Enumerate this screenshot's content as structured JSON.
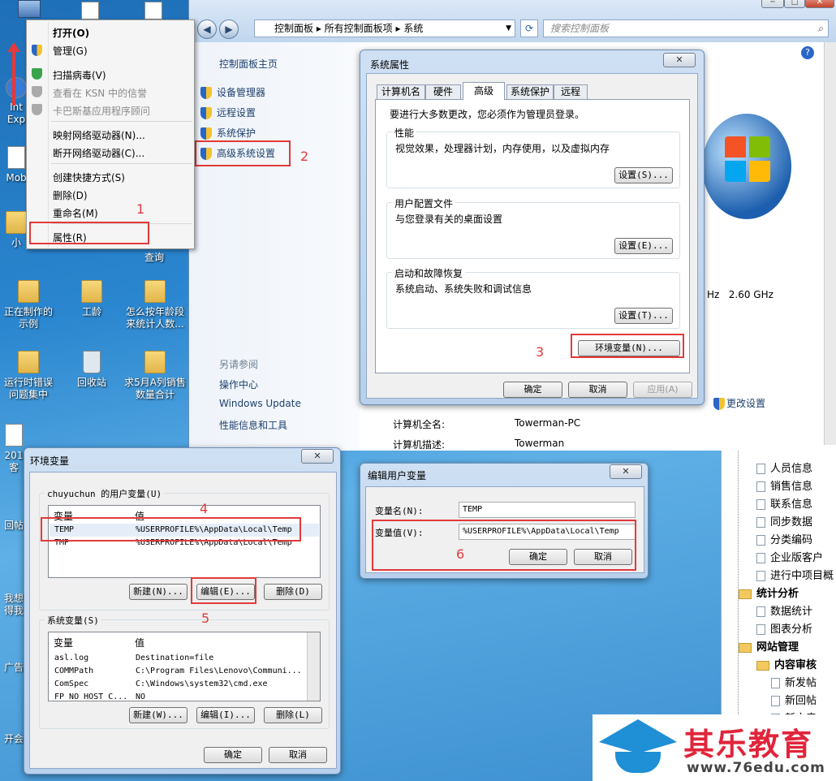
{
  "desktop": {
    "icons": [
      {
        "label": "Int Exp"
      },
      {
        "label": "Mob"
      },
      {
        "label": "小"
      },
      {
        "label": "正在制作的示例"
      },
      {
        "label": "工龄"
      },
      {
        "label": "怎么按年龄段来统计人数..."
      },
      {
        "label": "运行时错误问题集中"
      },
      {
        "label": "回收站"
      },
      {
        "label": "求5月A列销售数量合计"
      },
      {
        "label": "201 客"
      },
      {
        "label": "回帖"
      },
      {
        "label": "我想 得我"
      },
      {
        "label": "广告"
      },
      {
        "label": "开会"
      },
      {
        "label": "查询"
      }
    ]
  },
  "context_menu": {
    "items": [
      "打开(O)",
      "管理(G)",
      "扫描病毒(V)",
      "查看在 KSN 中的信誉",
      "卡巴斯基应用程序顾问",
      "映射网络驱动器(N)...",
      "断开网络驱动器(C)...",
      "创建快捷方式(S)",
      "删除(D)",
      "重命名(M)",
      "属性(R)"
    ]
  },
  "control_panel": {
    "breadcrumb": [
      "控制面板",
      "所有控制面板项",
      "系统"
    ],
    "search_placeholder": "搜索控制面板",
    "home": "控制面板主页",
    "links": [
      "设备管理器",
      "远程设置",
      "系统保护",
      "高级系统设置"
    ],
    "see_also": "另请参阅",
    "see_also_links": [
      "操作中心",
      "Windows Update",
      "性能信息和工具"
    ],
    "cpu_speed": "Hz   2.60 GHz",
    "change_settings": "更改设置",
    "computer_name_label": "计算机全名:",
    "computer_name_value": "Towerman-PC",
    "computer_desc_label": "计算机描述:",
    "computer_desc_value": "Towerman"
  },
  "sys_props": {
    "title": "系统属性",
    "tabs": [
      "计算机名",
      "硬件",
      "高级",
      "系统保护",
      "远程"
    ],
    "admin_note": "要进行大多数更改，您必须作为管理员登录。",
    "perf_title": "性能",
    "perf_desc": "视觉效果，处理器计划，内存使用，以及虚拟内存",
    "perf_btn": "设置(S)...",
    "profile_title": "用户配置文件",
    "profile_desc": "与您登录有关的桌面设置",
    "profile_btn": "设置(E)...",
    "startup_title": "启动和故障恢复",
    "startup_desc": "系统启动、系统失败和调试信息",
    "startup_btn": "设置(T)...",
    "env_btn": "环境变量(N)...",
    "ok": "确定",
    "cancel": "取消",
    "apply": "应用(A)"
  },
  "env_vars": {
    "title": "环境变量",
    "user_group": "chuyuchun 的用户变量(U)",
    "col_var": "变量",
    "col_val": "值",
    "user_rows": [
      {
        "name": "TEMP",
        "value": "%USERPROFILE%\\AppData\\Local\\Temp"
      },
      {
        "name": "TMP",
        "value": "%USERPROFILE%\\AppData\\Local\\Temp"
      }
    ],
    "new_btn": "新建(N)...",
    "edit_btn": "编辑(E)...",
    "delete_btn": "删除(D)",
    "sys_group": "系统变量(S)",
    "sys_rows": [
      {
        "name": "asl.log",
        "value": "Destination=file"
      },
      {
        "name": "COMMPath",
        "value": "C:\\Program Files\\Lenovo\\Communi..."
      },
      {
        "name": "ComSpec",
        "value": "C:\\Windows\\system32\\cmd.exe"
      },
      {
        "name": "FP_NO_HOST_C...",
        "value": "NO"
      }
    ],
    "sys_new_btn": "新建(W)...",
    "sys_edit_btn": "编辑(I)...",
    "sys_delete_btn": "删除(L)",
    "ok": "确定",
    "cancel": "取消"
  },
  "edit_var": {
    "title": "编辑用户变量",
    "name_label": "变量名(N):",
    "name_value": "TEMP",
    "value_label": "变量值(V):",
    "value_value": "%USERPROFILE%\\AppData\\Local\\Temp",
    "ok": "确定",
    "cancel": "取消"
  },
  "tree": {
    "items": [
      {
        "label": "人员信息",
        "kind": "people"
      },
      {
        "label": "销售信息",
        "kind": "doc"
      },
      {
        "label": "联系信息",
        "kind": "doc"
      },
      {
        "label": "同步数据",
        "kind": "sync"
      },
      {
        "label": "分类编码",
        "kind": "doc"
      },
      {
        "label": "企业版客户",
        "kind": "doc"
      },
      {
        "label": "进行中项目概",
        "kind": "doc"
      },
      {
        "label": "统计分析",
        "kind": "folder"
      },
      {
        "label": "数据统计",
        "kind": "doc"
      },
      {
        "label": "图表分析",
        "kind": "doc"
      },
      {
        "label": "网站管理",
        "kind": "folder"
      },
      {
        "label": "内容审核",
        "kind": "folder"
      },
      {
        "label": "新发帖",
        "kind": "doc"
      },
      {
        "label": "新回帖",
        "kind": "doc"
      },
      {
        "label": "新文章",
        "kind": "doc"
      }
    ]
  },
  "watermark": {
    "title": "其乐教育",
    "url": "www.76edu.com"
  },
  "annotations": [
    "1",
    "2",
    "3",
    "4",
    "5",
    "6"
  ]
}
